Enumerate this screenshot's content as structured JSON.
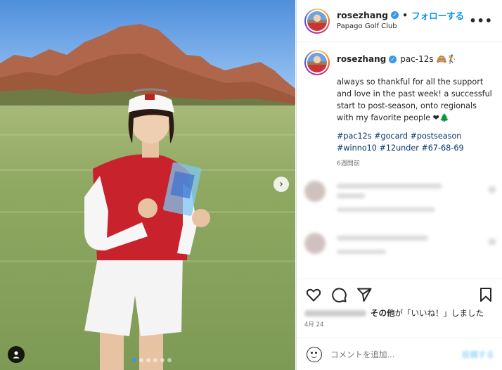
{
  "post": {
    "carousel_next_icon": "chevron-right-icon",
    "user_tag_icon": "person-icon",
    "slide_count": 6,
    "active_slide": 1
  },
  "header": {
    "username": "rosezhang",
    "verified_icon": "verified-badge-icon",
    "separator": "•",
    "follow_label": "フォローする",
    "location": "Papago Golf Club",
    "more_icon": "more-horizontal-icon"
  },
  "caption": {
    "username": "rosezhang",
    "tag": "pac-12s 🙈🏌",
    "text": "always so thankful for all the support and love in the past week! a successful start to post-season, onto regionals with my favorite people ❤🌲",
    "hashtags": [
      "#pac12s",
      "#gocard",
      "#postseason",
      "#winno10",
      "#12under",
      "#67-68-69"
    ],
    "time": "6週間前"
  },
  "actions": {
    "like_icon": "heart-icon",
    "comment_icon": "comment-icon",
    "share_icon": "send-icon",
    "save_icon": "bookmark-icon",
    "likes_suffix_bold": "その他",
    "likes_text": "が「いいね！」しました",
    "date": "4月 24"
  },
  "comment_box": {
    "emoji_icon": "emoji-icon",
    "placeholder": "コメントを追加...",
    "post_label": "投稿する"
  },
  "colors": {
    "accent": "#0095f6",
    "link": "#00376b",
    "text": "#262626",
    "muted": "#737373",
    "border": "#dbdbdb"
  }
}
